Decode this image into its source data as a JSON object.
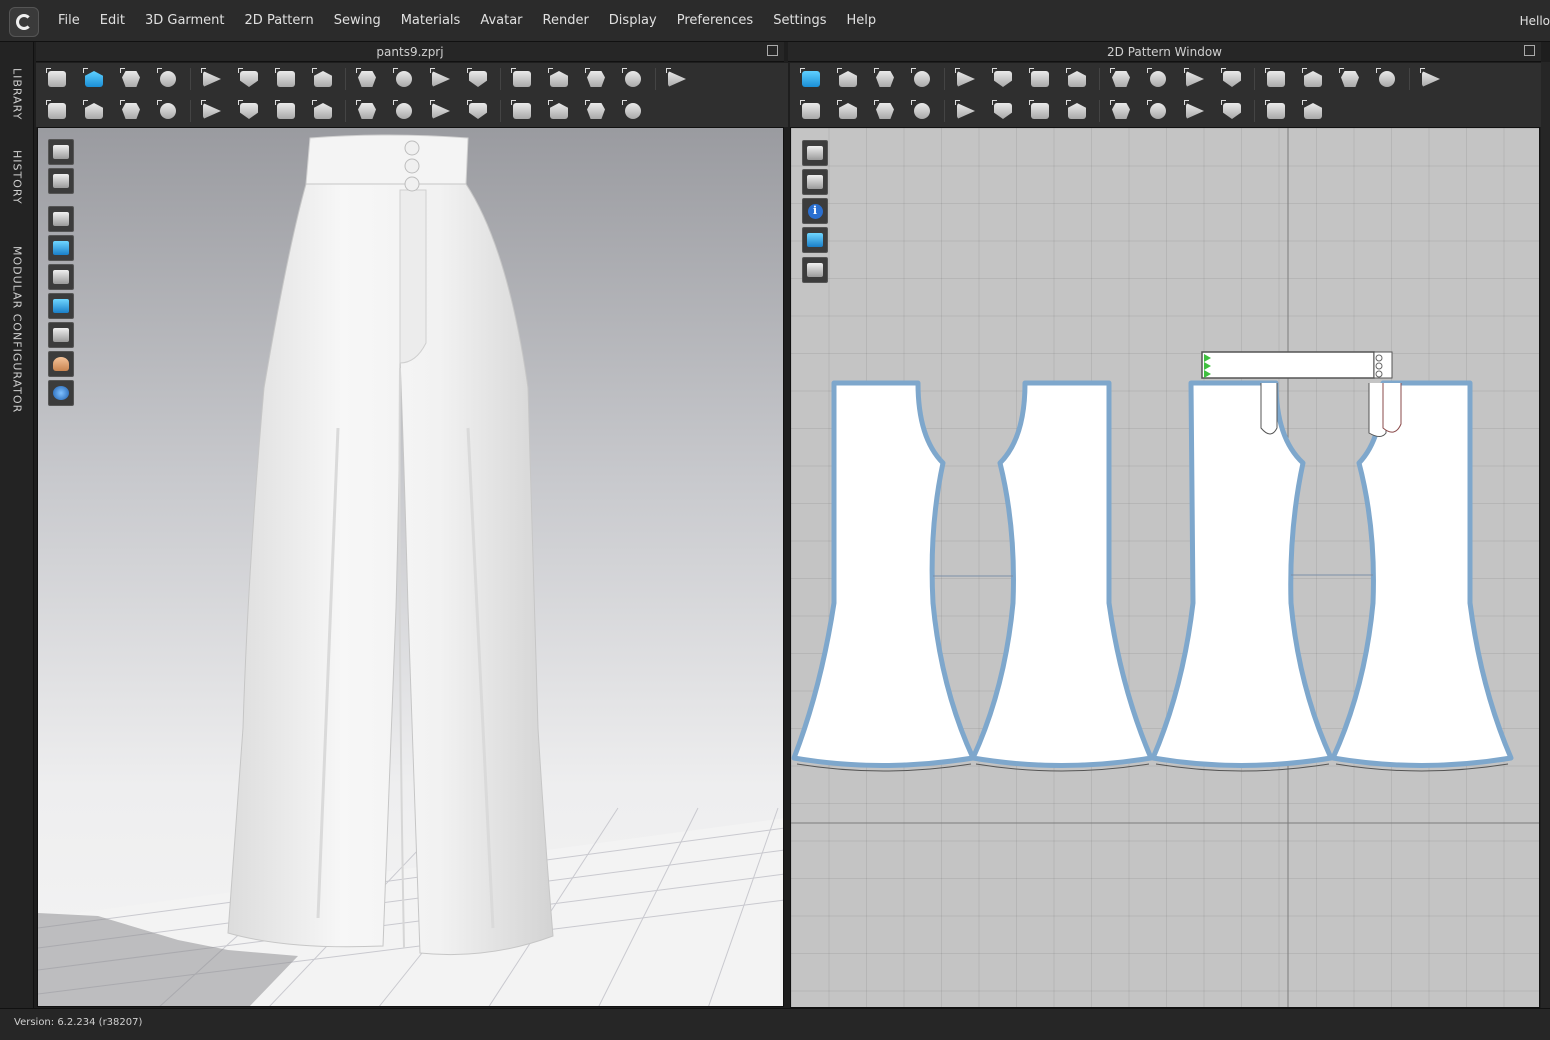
{
  "menubar": {
    "items": [
      "File",
      "Edit",
      "3D Garment",
      "2D Pattern",
      "Sewing",
      "Materials",
      "Avatar",
      "Render",
      "Display",
      "Preferences",
      "Settings",
      "Help"
    ],
    "user_greeting": "Hello"
  },
  "side_tabs": [
    "LIBRARY",
    "HISTORY",
    "MODULAR CONFIGURATOR"
  ],
  "windows": {
    "viewport_3d_title": "pants9.zprj",
    "viewport_2d_title": "2D Pattern Window"
  },
  "status": {
    "version": "Version: 6.2.234 (r38207)"
  },
  "icons": {
    "toolbar_3d_row1": [
      "simulation-icon",
      "select-move-icon",
      "transform-pattern-icon",
      "fold-arrangement-icon",
      "tack-icon",
      "pin-icon",
      "zipper-icon",
      "strap-icon",
      "line-icon",
      "puckering-icon",
      "pattern-outline-icon",
      "garment-icon",
      "avatar-arrange-icon",
      "arrangement-point-icon",
      "fitting-suit-icon",
      "measure-icon",
      "expand-icon"
    ],
    "toolbar_3d_row2": [
      "avatar-pose-icon",
      "edit-sewing-icon",
      "segment-sewing-icon",
      "free-sewing-icon",
      "tuck-icon",
      "fold-icon",
      "button-icon",
      "buttonhole-icon",
      "topstitch-icon",
      "trim-icon",
      "pin-add-icon",
      "zipper-add-icon",
      "puckering-add-icon",
      "graphic-icon",
      "texture-icon",
      "expand-icon"
    ],
    "toolbar_2d_row1": [
      "edit-pattern-icon",
      "edit-curve-icon",
      "polygon-icon",
      "rectangle-icon",
      "internal-polygon-icon",
      "internal-rectangle-icon",
      "dart-icon",
      "cut-sew-icon",
      "trace-icon",
      "symmetry-icon",
      "grading-icon",
      "ruler-icon",
      "text-icon",
      "annotation-icon",
      "grain-line-icon",
      "notch-icon",
      "pattern-settings-icon"
    ],
    "toolbar_2d_row2": [
      "segment-sewing-icon",
      "free-sewing-icon",
      "edit-sewing-icon",
      "check-sewing-icon",
      "iron-icon",
      "garment-2d-icon",
      "button-2d-icon",
      "buttonhole-2d-icon",
      "baseline-icon",
      "topstitch-2d-icon",
      "seam-allowance-icon",
      "zigzag-stitch-icon",
      "graphic-2d-icon",
      "grid-icon"
    ],
    "viewport_3d_tools": [
      "fabric-display-icon",
      "garment-display-icon",
      "show-garment-icon",
      "show-pattern-icon",
      "show-avatar-icon",
      "texture-surface-icon",
      "shaded-surface-icon",
      "avatar-display-icon",
      "environment-icon"
    ],
    "viewport_2d_tools": [
      "show-baseline-icon",
      "show-garment-2d-icon",
      "show-pattern-info-icon",
      "show-texture-2d-icon",
      "lock-pattern-icon"
    ]
  },
  "colors": {
    "accent_blue": "#1b8fd6",
    "pattern_outline": "#7ea7cc",
    "pattern_fill": "#ffffff"
  }
}
